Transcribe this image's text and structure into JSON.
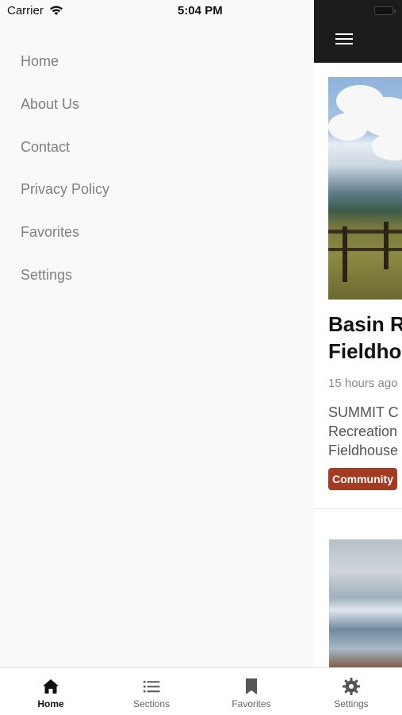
{
  "status_bar": {
    "carrier": "Carrier",
    "time": "5:04 PM"
  },
  "drawer": {
    "items": [
      {
        "label": "Home"
      },
      {
        "label": "About Us"
      },
      {
        "label": "Contact"
      },
      {
        "label": "Privacy Policy"
      },
      {
        "label": "Favorites"
      },
      {
        "label": "Settings"
      }
    ]
  },
  "feed": {
    "articles": [
      {
        "title_line1": "Basin Re",
        "title_line2": "Fieldhou",
        "time": "15 hours ago",
        "excerpt_line1": "SUMMIT C",
        "excerpt_line2": "Recreation",
        "excerpt_line3": "Fieldhouse",
        "tag": "Community"
      }
    ]
  },
  "tab_bar": {
    "tabs": [
      {
        "label": "Home",
        "icon": "home-icon",
        "active": true
      },
      {
        "label": "Sections",
        "icon": "list-icon",
        "active": false
      },
      {
        "label": "Favorites",
        "icon": "bookmark-icon",
        "active": false
      },
      {
        "label": "Settings",
        "icon": "gear-icon",
        "active": false
      }
    ]
  },
  "colors": {
    "header_bg": "#1c1c1c",
    "drawer_bg": "#f9f9f9",
    "tag_bg": "#a33a22",
    "menu_text": "#808080"
  }
}
